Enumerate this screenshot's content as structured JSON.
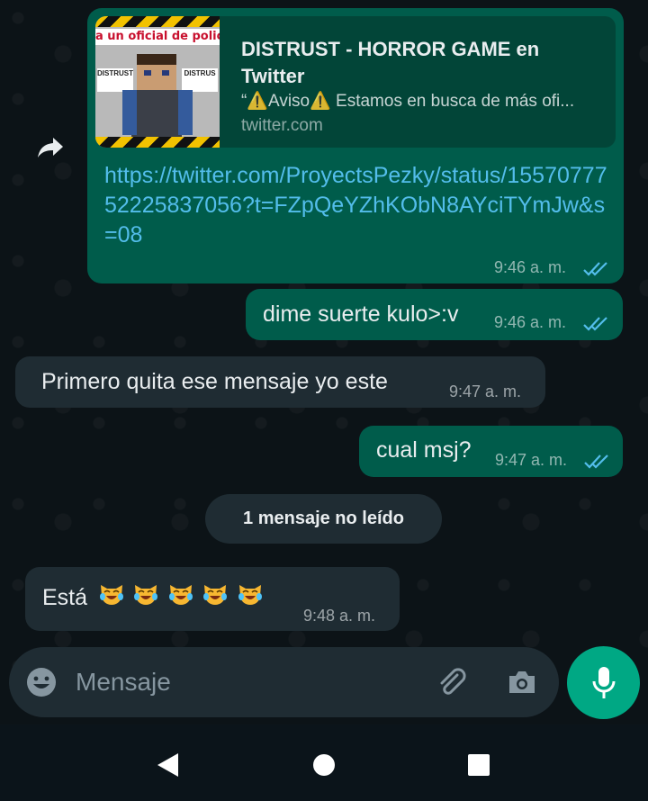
{
  "messages": {
    "link": {
      "preview_title": "DISTRUST - HORROR GAME en Twitter",
      "preview_desc": "“⚠️Aviso⚠️ Estamos en busca de más ofi...",
      "preview_domain": "twitter.com",
      "thumb_banner": "a un oficial de policía",
      "thumb_sign_left": "DISTRUST",
      "thumb_sign_right": "DISTRUS",
      "url": "https://twitter.com/ProyectsPezky/status/1557077752225837056?t=FZpQeYZhKObN8AYciTYmJw&s=08",
      "time": "9:46 a. m.",
      "status": "read"
    },
    "m2": {
      "text": "dime suerte kulo>:v",
      "time": "9:46 a. m.",
      "status": "read"
    },
    "m3": {
      "text": "Primero quita ese mensaje yo este",
      "time": "9:47 a. m."
    },
    "m4": {
      "text": "cual msj?",
      "time": "9:47 a. m.",
      "status": "read"
    },
    "unread_divider": "1 mensaje no leído",
    "m5": {
      "text": "Está",
      "emoji_count": 5,
      "emoji_name": "cat-tears-of-joy",
      "time": "9:48 a. m."
    }
  },
  "composer": {
    "placeholder": "Mensaje",
    "icons": [
      "emoji-icon",
      "attach-icon",
      "camera-icon",
      "mic-icon"
    ]
  },
  "nav": {
    "icons": [
      "back-icon",
      "home-icon",
      "recents-icon"
    ]
  },
  "colors": {
    "outgoing_bubble": "#005c4b",
    "incoming_bubble": "#1f2c33",
    "link": "#53bdeb",
    "read_ticks": "#53bdeb",
    "mic_button": "#00a884"
  }
}
